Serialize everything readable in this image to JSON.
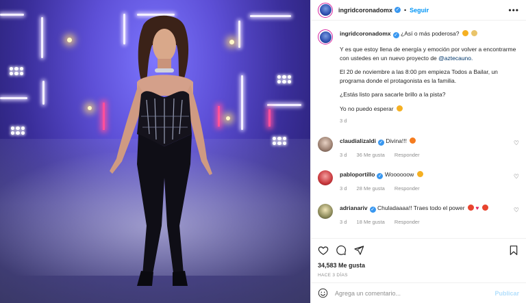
{
  "post": {
    "author": "ingridcoronadomx",
    "follow_label": "Seguir",
    "more_icon": "more-options-icon"
  },
  "caption": {
    "author": "ingridcoronadomx",
    "line1": "¿Así o más poderosa?",
    "p2_text": "Y es que estoy llena de energía y emoción por volver a encontrarme con ustedes en un nuevo proyecto de",
    "p2_mention": "@aztecauno.",
    "p3": "El 20 de noviembre a las 8:00 pm empieza Todos a Bailar, un programa donde el protagonista es la familia.",
    "p4": "¿Estás listo para sacarle brillo a la pista?",
    "p5": "Yo no puedo esperar",
    "time": "3 d"
  },
  "comments": [
    {
      "user": "claudializaldi",
      "text": "Divina!!!",
      "time": "3 d",
      "likes": "36 Me gusta",
      "reply": "Responder"
    },
    {
      "user": "pabloportillo",
      "text": "Woooooow",
      "time": "3 d",
      "likes": "28 Me gusta",
      "reply": "Responder"
    },
    {
      "user": "adrianariv",
      "text": "Chuladaaaa!! Traes todo el power",
      "time": "3 d",
      "likes": "18 Me gusta",
      "reply": "Responder"
    }
  ],
  "actions": {
    "likes": "34,583 Me gusta",
    "ago": "HACE 3 DÍAS"
  },
  "add_comment": {
    "placeholder": "Agrega un comentario...",
    "publish": "Publicar"
  },
  "colors": {
    "accent_blue": "#0095f6",
    "verified_blue": "#3897f0",
    "muted": "#8e8e8e"
  }
}
